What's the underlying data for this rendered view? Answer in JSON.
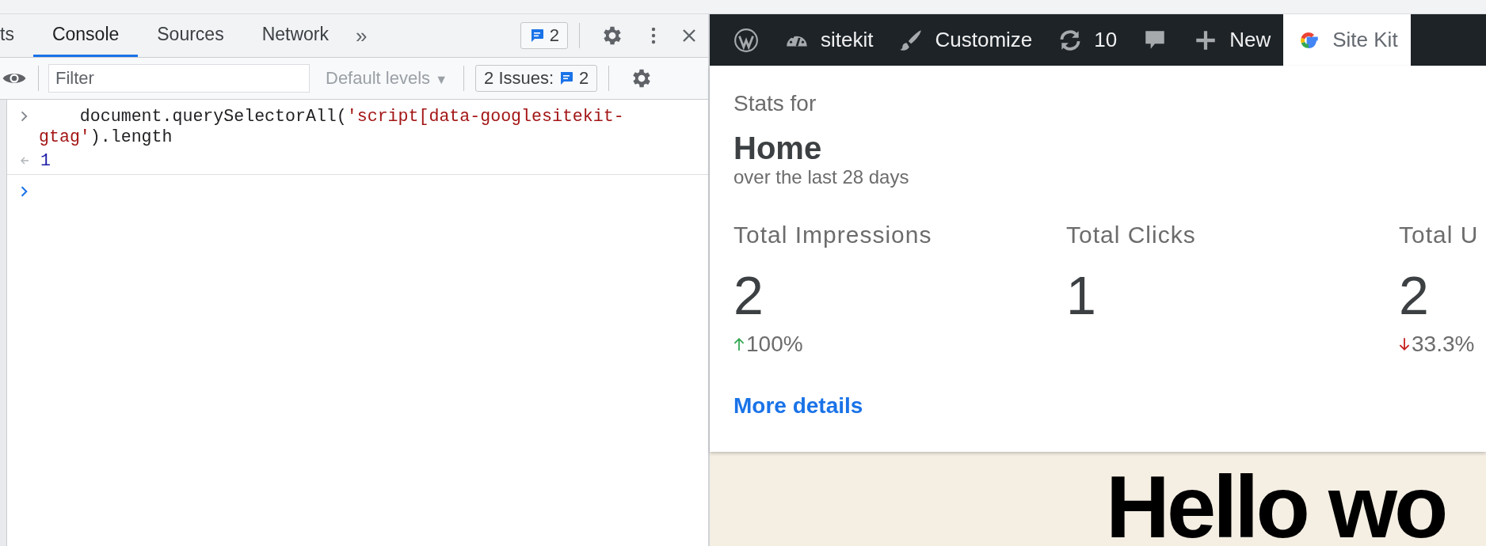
{
  "devtools": {
    "tabs": [
      {
        "label": "ts",
        "selected": false
      },
      {
        "label": "Console",
        "selected": true
      },
      {
        "label": "Sources",
        "selected": false
      },
      {
        "label": "Network",
        "selected": false
      }
    ],
    "more_tabs": "»",
    "messages_badge": "2",
    "toolbar": {
      "filter": {
        "placeholder": "Filter"
      },
      "levels": "Default levels",
      "levels_caret": "▼",
      "issues_label": "2 Issues:",
      "issues_count": "2"
    },
    "console": {
      "input": [
        {
          "kind": "code",
          "text": "    document.querySelectorAll("
        },
        {
          "kind": "string",
          "text": "'script[data-googlesitekit-gtag'"
        },
        {
          "kind": "code",
          "text": ").length"
        }
      ],
      "result": "1"
    }
  },
  "admin_bar": {
    "items": [
      {
        "kind": "wordpress",
        "selected": false
      },
      {
        "kind": "site",
        "label": "sitekit",
        "selected": false
      },
      {
        "kind": "customize",
        "label": "Customize",
        "selected": false
      },
      {
        "kind": "updates",
        "label": "10",
        "selected": false
      },
      {
        "kind": "comments",
        "selected": false
      },
      {
        "kind": "new",
        "label": "New",
        "selected": false
      },
      {
        "kind": "sitekit",
        "label": "Site Kit",
        "selected": true
      }
    ]
  },
  "stats": {
    "heading": "Stats for",
    "page": "Home",
    "period": "over the last 28 days",
    "metrics": [
      {
        "label": "Total Impressions",
        "value": "2",
        "change": "100%",
        "increase": true
      },
      {
        "label": "Total Clicks",
        "value": "1"
      },
      {
        "label": "Total U",
        "value": "2",
        "change": "33.3%",
        "increase": false
      }
    ],
    "link": "More details"
  },
  "page": {
    "heading": "Hello wo"
  }
}
